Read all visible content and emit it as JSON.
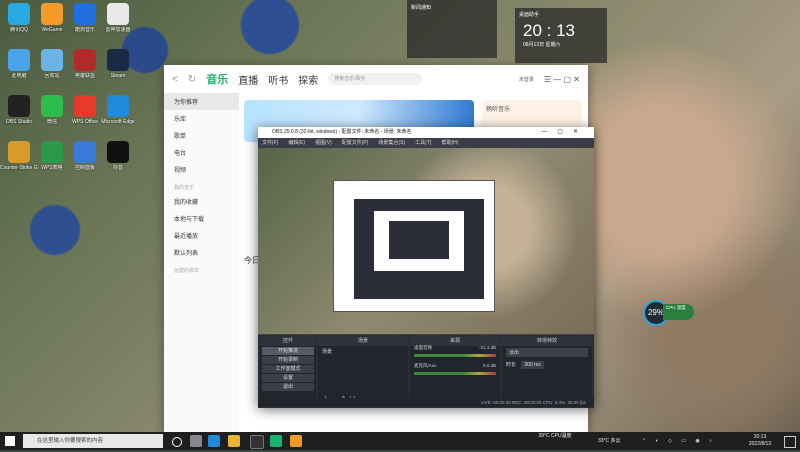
{
  "desktop_icons": [
    {
      "label": "腾讯QQ",
      "color": "#2aa9e0"
    },
    {
      "label": "WeGame",
      "color": "#f39a2a"
    },
    {
      "label": "酷狗音乐",
      "color": "#1f6fe0"
    },
    {
      "label": "雷神加速器",
      "color": "#e8e8e8"
    },
    {
      "label": "此电脑",
      "color": "#4aa3e8"
    },
    {
      "label": "回收站",
      "color": "#6bb4e8"
    },
    {
      "label": "英雄联盟",
      "color": "#b02a2a"
    },
    {
      "label": "Steam",
      "color": "#1a2a44"
    },
    {
      "label": "OBS Studio",
      "color": "#222"
    },
    {
      "label": "微信",
      "color": "#2dbd4a"
    },
    {
      "label": "WPS Office",
      "color": "#e83a2a"
    },
    {
      "label": "Microsoft Edge",
      "color": "#1f8ad8"
    },
    {
      "label": "Counter-Strike Global",
      "color": "#d89a2a"
    },
    {
      "label": "WPS表格",
      "color": "#2a9a4a"
    },
    {
      "label": "控制面板",
      "color": "#3a7ad8"
    },
    {
      "label": "抖音",
      "color": "#111"
    }
  ],
  "music_app": {
    "tabs": [
      "音乐",
      "直播",
      "听书",
      "探索"
    ],
    "search_placeholder": "搜索音乐/歌手",
    "user": "未登录",
    "sidebar": [
      "为你推荐",
      "乐库",
      "歌单",
      "电台",
      "视频"
    ],
    "sidebar_section": "我的音乐",
    "sidebar_items2": [
      "我的收藏",
      "本地与下载",
      "最近播放",
      "默认列表"
    ],
    "sidebar_section2": "创建的歌单",
    "banner_title": "畅听音乐",
    "section_title": "今日推荐"
  },
  "obs": {
    "title": "OBS 25.0.8 (32-bit, windows) - 配置文件: 未命名 - 场景: 未命名",
    "menu": [
      "文件(F)",
      "编辑(E)",
      "视图(V)",
      "配置文件(P)",
      "场景集合(S)",
      "工具(T)",
      "帮助(H)"
    ],
    "dock_headers": [
      "控件",
      "场景",
      "来源",
      "混音器",
      "转场特效"
    ],
    "controls": [
      "开始推流",
      "开始录制",
      "工作室模式",
      "设置",
      "退出"
    ],
    "scene": "场景",
    "mixer": [
      "桌面音频",
      "麦克风/Aux"
    ],
    "mixer_db": [
      "-21.4 dB",
      "0.0 dB"
    ],
    "transition": "淡出",
    "duration_label": "时长",
    "duration": "300 ms",
    "status": "LIVE: 00:00:00   REC: 00:00:00   CPU: 0.4%, 30.00 fps"
  },
  "widgets": {
    "weather_label": "桌面助手",
    "time": "20 : 13",
    "date": "08月13日 星期六",
    "notice_label": "新闻通知"
  },
  "cpu_badge": "29%",
  "cpu_pill": "CPU 温度",
  "taskbar": {
    "search": "在这里输入你要搜索的内容",
    "weather": "33°C 多云",
    "time": "20:13",
    "date": "2022/8/13",
    "cpu": "39°C CPU温度"
  }
}
